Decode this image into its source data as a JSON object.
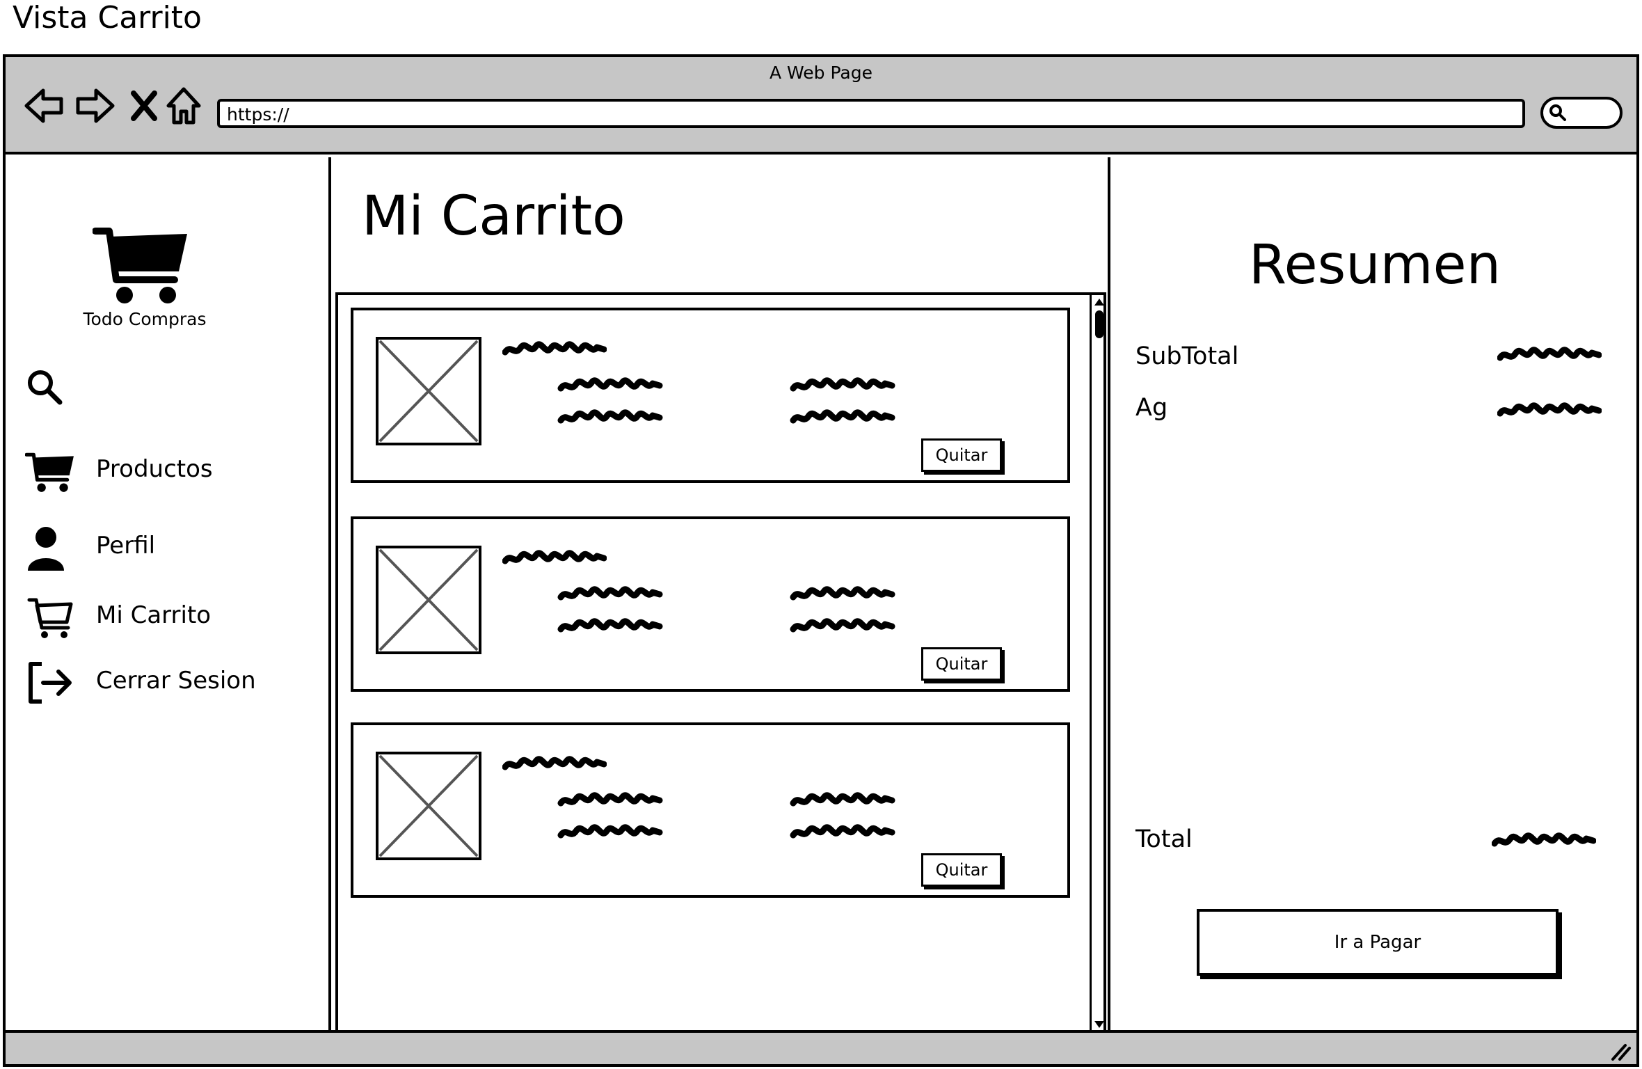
{
  "diagram_title": "Vista Carrito",
  "browser": {
    "window_title": "A Web Page",
    "url": "https://",
    "nav_icons": [
      "back-arrow-icon",
      "forward-arrow-icon",
      "close-x-icon",
      "home-icon"
    ],
    "search_icon": "search-icon"
  },
  "sidebar": {
    "brand_label": "Todo Compras",
    "brand_icon": "shopping-cart-icon",
    "items": [
      {
        "label": "Productos",
        "icon": "shopping-cart-icon"
      },
      {
        "label": "Perfil",
        "icon": "user-icon"
      },
      {
        "label": "Mi Carrito",
        "icon": "cart-outline-icon"
      },
      {
        "label": "Cerrar Sesion",
        "icon": "logout-icon"
      }
    ]
  },
  "main": {
    "title": "Mi Carrito",
    "items": [
      {
        "remove_label": "Quitar"
      },
      {
        "remove_label": "Quitar"
      },
      {
        "remove_label": "Quitar"
      }
    ]
  },
  "summary": {
    "title": "Resumen",
    "subtotal_label": "SubTotal",
    "tax_label": "Ag",
    "total_label": "Total",
    "pay_label": "Ir a Pagar"
  }
}
